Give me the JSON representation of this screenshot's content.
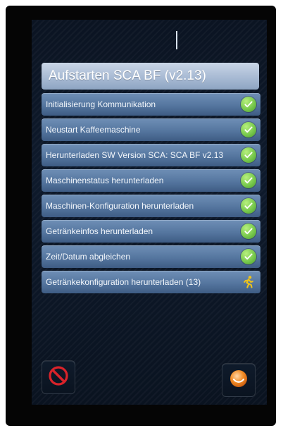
{
  "header": {
    "title": "Aufstarten SCA BF (v2.13)"
  },
  "steps": [
    {
      "label": "Initialisierung Kommunikation",
      "status": "done",
      "icon": "check-circle-icon"
    },
    {
      "label": "Neustart Kaffeemaschine",
      "status": "done",
      "icon": "check-circle-icon"
    },
    {
      "label": "Herunterladen SW Version SCA: SCA BF v2.13",
      "status": "done",
      "icon": "check-circle-icon"
    },
    {
      "label": "Maschinenstatus herunterladen",
      "status": "done",
      "icon": "check-circle-icon"
    },
    {
      "label": "Maschinen-Konfiguration herunterladen",
      "status": "done",
      "icon": "check-circle-icon"
    },
    {
      "label": "Getränkeinfos herunterladen",
      "status": "done",
      "icon": "check-circle-icon"
    },
    {
      "label": "Zeit/Datum abgleichen",
      "status": "done",
      "icon": "check-circle-icon"
    },
    {
      "label": "Getränkekonfiguration herunterladen (13)",
      "status": "running",
      "icon": "running-person-icon"
    }
  ],
  "buttons": {
    "cancel_icon": "no-entry-icon",
    "confirm_icon": "orange-circle-icon"
  },
  "colors": {
    "row_bg": "#55769f",
    "header_bg": "#aebfd7",
    "check_green": "#78c94d",
    "running_yellow": "#f0c419",
    "cancel_red": "#d9232a",
    "confirm_orange": "#f08a24"
  }
}
